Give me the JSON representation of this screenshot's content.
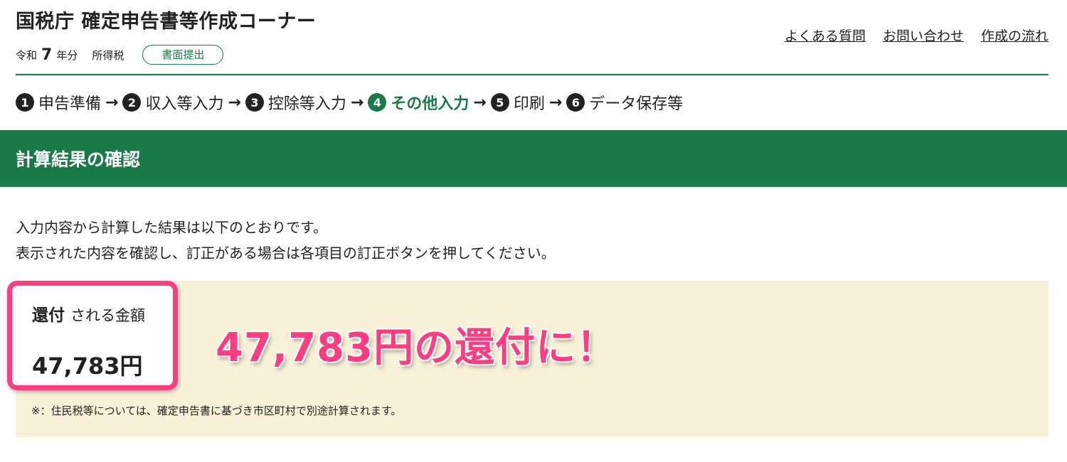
{
  "header": {
    "app_title": "国税庁 確定申告書等作成コーナー",
    "era": "令和",
    "year": "7",
    "year_unit": "年分",
    "tax_type": "所得税",
    "submission_badge": "書面提出",
    "links": [
      "よくある質問",
      "お問い合わせ",
      "作成の流れ"
    ]
  },
  "steps": [
    {
      "num": "1",
      "label": "申告準備",
      "current": false
    },
    {
      "num": "2",
      "label": "収入等入力",
      "current": false
    },
    {
      "num": "3",
      "label": "控除等入力",
      "current": false
    },
    {
      "num": "4",
      "label": "その他入力",
      "current": true
    },
    {
      "num": "5",
      "label": "印刷",
      "current": false
    },
    {
      "num": "6",
      "label": "データ保存等",
      "current": false
    }
  ],
  "step_arrow": "→",
  "section": {
    "title": "計算結果の確認",
    "intro_lines": [
      "入力内容から計算した結果は以下のとおりです。",
      "表示された内容を確認し、訂正がある場合は各項目の訂正ボタンを押してください。"
    ]
  },
  "result": {
    "label_strong": "還付",
    "label_rest": "される金額",
    "amount": "47,783円",
    "note": "※：住民税等については、確定申告書に基づき市区町村で別途計算されます。"
  },
  "annotation": {
    "callout": "47,783円の還付に！"
  },
  "colors": {
    "brand_green": "#1a7a47",
    "panel_bg": "#f8f1d7",
    "highlight_pink": "#ff3d7f"
  }
}
